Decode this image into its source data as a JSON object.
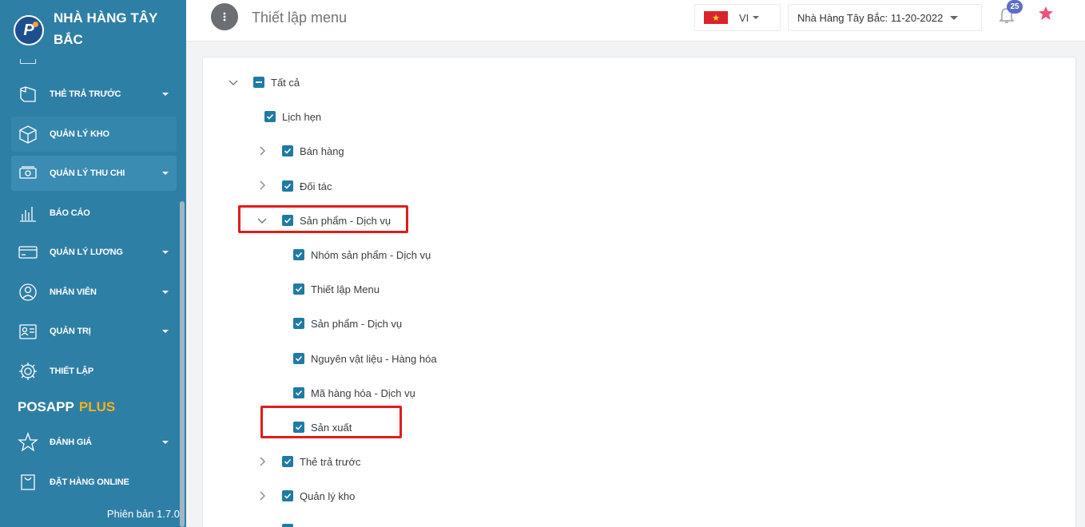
{
  "brand": {
    "name": "NHÀ HÀNG TÂY BẮC",
    "logo_letter": "P"
  },
  "sidebar": {
    "items": [
      {
        "label": "THẺ TRẢ TRƯỚC",
        "icon": "prepaid-card-icon",
        "has_caret": true
      },
      {
        "label": "QUẢN LÝ KHO",
        "icon": "box-icon",
        "has_caret": false
      },
      {
        "label": "QUẢN LÝ THU CHI",
        "icon": "cash-icon",
        "has_caret": true
      },
      {
        "label": "BÁO CÁO",
        "icon": "bar-chart-icon",
        "has_caret": false
      },
      {
        "label": "QUẢN LÝ LƯƠNG",
        "icon": "credit-card-icon",
        "has_caret": true
      },
      {
        "label": "NHÂN VIÊN",
        "icon": "user-icon",
        "has_caret": true
      },
      {
        "label": "QUẢN TRỊ",
        "icon": "id-card-icon",
        "has_caret": true
      },
      {
        "label": "THIẾT LẬP",
        "icon": "gear-icon",
        "has_caret": false
      },
      {
        "label": "ĐÁNH GIÁ",
        "icon": "star-outline-icon",
        "has_caret": true
      },
      {
        "label": "ĐẶT HÀNG ONLINE",
        "icon": "shopping-bag-icon",
        "has_caret": false
      }
    ],
    "plus_brand_a": "POSAPP",
    "plus_brand_b": "PLUS",
    "version": "Phiên bản 1.7.0"
  },
  "header": {
    "title": "Thiết lập menu",
    "language": "VI",
    "store": "Nhà Hàng Tây Bắc: 11-20-2022",
    "notification_count": "25"
  },
  "tree": {
    "root": "Tất cả",
    "nodes": {
      "lich_hen": "Lịch hẹn",
      "ban_hang": "Bán hàng",
      "doi_tac": "Đối tác",
      "san_pham_dich_vu": "Sản phẩm - Dịch vụ",
      "nhom_san_pham": "Nhóm sản phẩm - Dịch vụ",
      "thiet_lap_menu": "Thiết lập Menu",
      "san_pham_dich_vu_child": "Sản phẩm - Dịch vụ",
      "nguyen_vat_lieu": "Nguyên vật liệu - Hàng hóa",
      "ma_hang_hoa": "Mã hàng hóa - Dịch vụ",
      "san_xuat": "Sản xuất",
      "the_tra_truoc": "Thẻ trả trước",
      "quan_ly_kho": "Quản lý kho"
    }
  },
  "colors": {
    "sidebar": "#2e7fa6",
    "checkbox": "#1f7ba3",
    "highlight": "#e21b1b",
    "plus": "#f2b21b"
  }
}
